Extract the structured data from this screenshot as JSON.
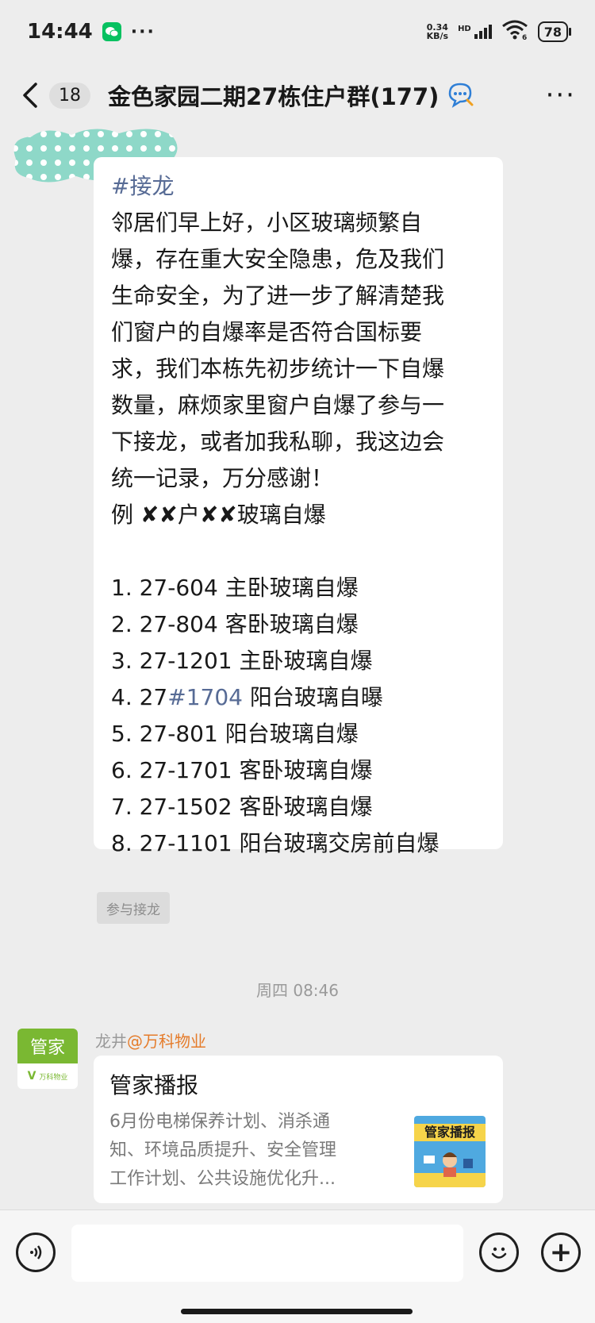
{
  "status_bar": {
    "time": "14:44",
    "more": "···",
    "net_speed_value": "0.34",
    "net_speed_unit": "KB/s",
    "hd": "HD",
    "wifi_label": "6",
    "battery": "78"
  },
  "header": {
    "back_count": "18",
    "title": "金色家园二期27栋住户群(177)",
    "more": "···"
  },
  "message1": {
    "hashtag": "#接龙",
    "lines": [
      "邻居们早上好，小区玻璃频繁自",
      "爆，存在重大安全隐患，危及我们",
      "生命安全，为了进一步了解清楚我",
      "们窗户的自爆率是否符合国标要",
      "求，我们本栋先初步统计一下自爆",
      "数量，麻烦家里窗户自爆了参与一",
      "下接龙，或者加我私聊，我这边会",
      "统一记录，万分感谢！"
    ],
    "example_prefix": "例 ",
    "example_xx1": "✘✘",
    "example_mid": "户",
    "example_xx2": "✘✘",
    "example_suffix": "玻璃自爆",
    "entries": [
      "1. 27-604  主卧玻璃自爆",
      "2. 27-804 客卧玻璃自爆",
      "3. 27-1201 主卧玻璃自爆",
      "5. 27-801 阳台玻璃自爆",
      "6. 27-1701 客卧玻璃自爆",
      "7. 27-1502 客卧玻璃自爆",
      "8. 27-1101 阳台玻璃交房前自爆"
    ],
    "entry4_prefix": "4. 27",
    "entry4_tag": "#1704",
    "entry4_suffix": "  阳台玻璃自曝"
  },
  "jielong_button": "参与接龙",
  "timestamp": "周四 08:46",
  "message2": {
    "avatar_top": "管家",
    "avatar_brand": "万科物业",
    "sender_name": "龙井",
    "sender_at": "@万科物业",
    "card_title": "管家播报",
    "card_desc_lines": [
      "6月份电梯保养计划、消杀通",
      "知、环境品质提升、安全管理",
      "工作计划、公共设施优化升..."
    ],
    "thumb_label": "管家播报"
  },
  "input_bar": {
    "placeholder": "",
    "plus": "+"
  },
  "colors": {
    "background": "#ededed",
    "bubble": "#ffffff",
    "link": "#576b95",
    "mention": "#e57c2b",
    "brand_green": "#7ab832",
    "wechat_green": "#07c160"
  },
  "icons": {
    "back": "chevron-left-icon",
    "search_chat": "chat-search-icon",
    "more": "more-dots-icon",
    "voice": "voice-icon",
    "emoji": "emoji-icon",
    "plus": "plus-icon",
    "wifi": "wifi-icon",
    "signal": "signal-icon",
    "battery": "battery-icon",
    "wechat": "wechat-icon"
  }
}
